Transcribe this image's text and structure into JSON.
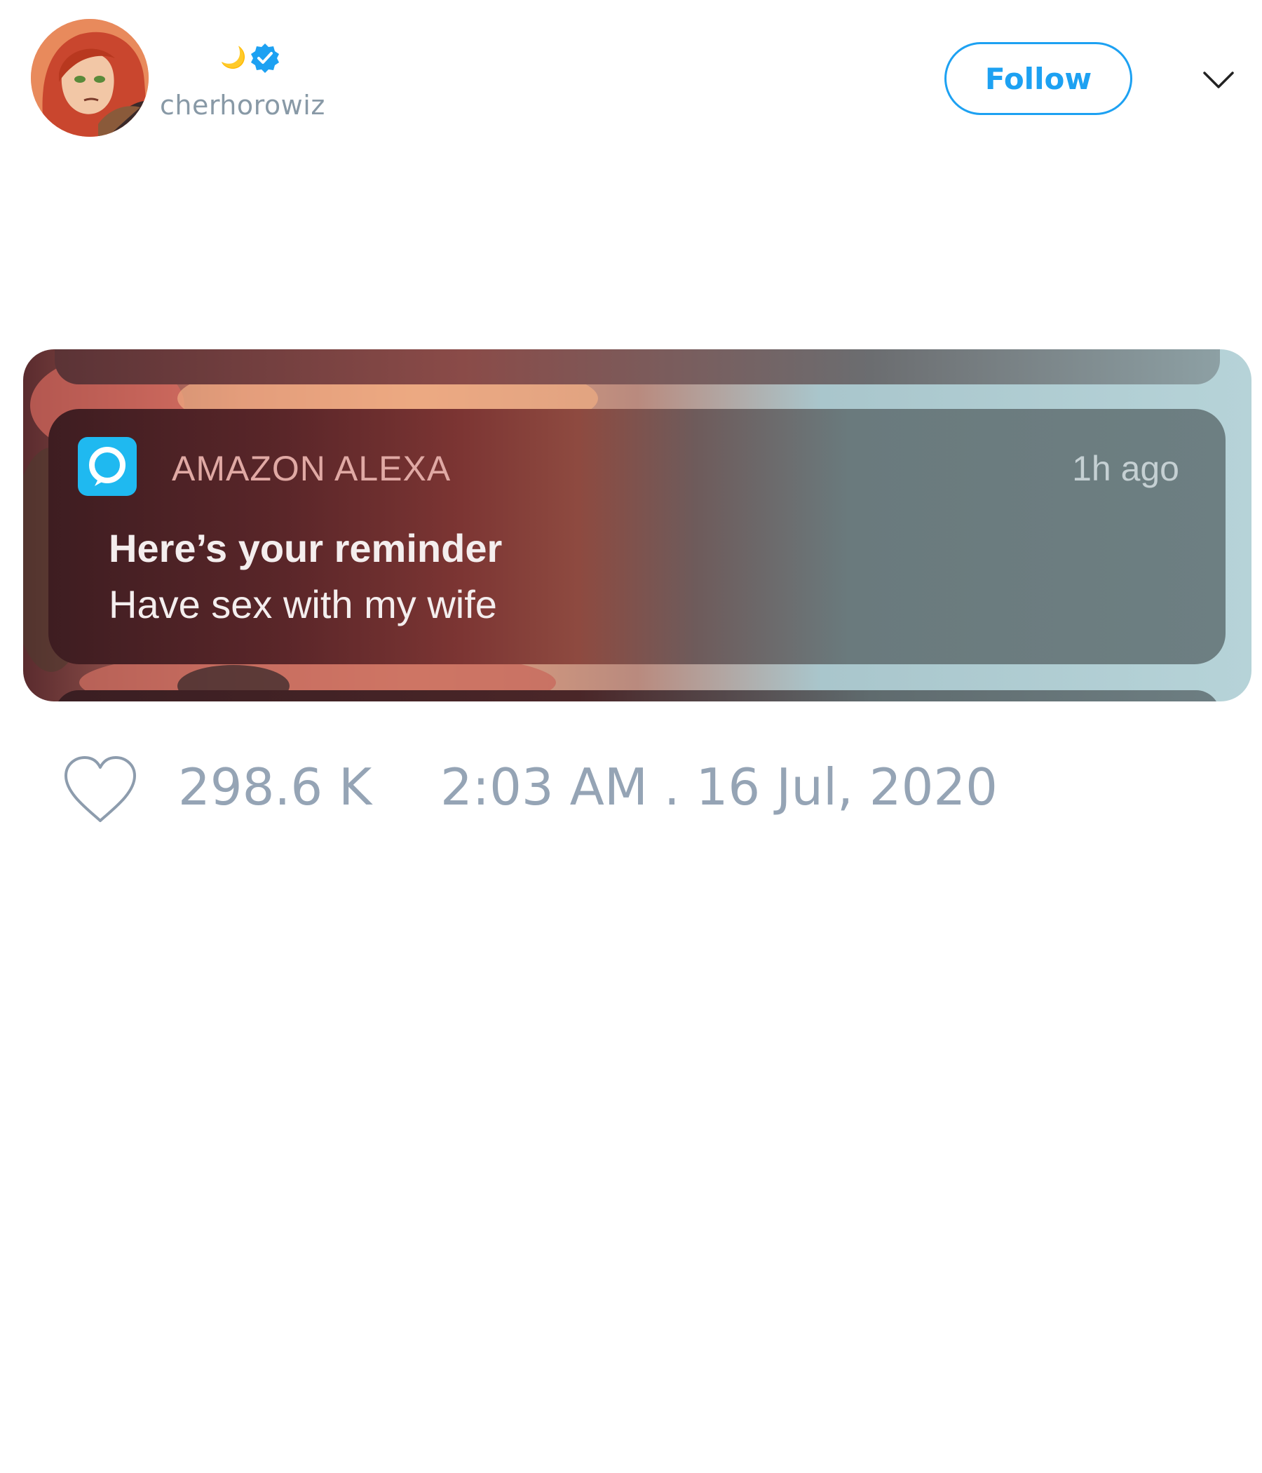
{
  "tweet": {
    "author": {
      "display_name_emoji": "🌙",
      "verified_icon": "verified-badge-icon",
      "handle": "cherhorowiz",
      "avatar_icon": "avatar"
    },
    "follow_label": "Follow",
    "menu_icon": "chevron-down-icon",
    "media": {
      "notification": {
        "app_icon": "alexa-icon",
        "app_name": "AMAZON ALEXA",
        "time": "1h ago",
        "title": "Here’s your reminder",
        "body": "Have sex with my wife"
      }
    },
    "likes": "298.6 K",
    "timestamp": "2:03 AM . 16 Jul, 2020"
  },
  "colors": {
    "accent": "#1da1f2",
    "muted_text": "#95a4b5",
    "alexa_blue": "#1fb9f0"
  }
}
